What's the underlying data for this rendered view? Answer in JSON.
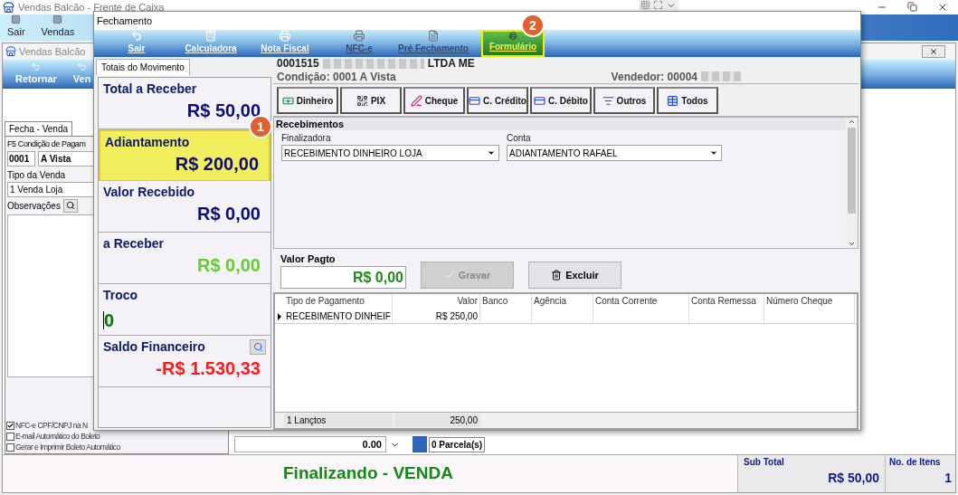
{
  "app": {
    "title": "Vendas Balcão - Frente de Caixa",
    "toolbar": [
      {
        "label": "Sair"
      },
      {
        "label": "Vendas"
      }
    ]
  },
  "child_window": {
    "title": "Vendas Balcão",
    "toolbar": [
      {
        "label": "Retornar"
      },
      {
        "label": "Ven"
      }
    ],
    "tab": {
      "label": "Fecha - Venda",
      "selected": true
    },
    "condition_label": "F5 Condição de Pagam",
    "condition_code": "0001",
    "condition_name": "A Vista",
    "sale_type_label": "Tipo da Venda",
    "sale_type": "1 Venda Loja",
    "notes_label": "Observações",
    "options": [
      {
        "label": "NFC-e CPF/CNPJ na N",
        "checked": true
      },
      {
        "label": "E-mail Automático do Boleto",
        "checked": false
      },
      {
        "label": "Gerar e Imprimir Boleto Automático",
        "checked": false
      }
    ],
    "installment_value": "0.00",
    "installments": "0 Parcela(s)",
    "status": "Finalizando - VENDA",
    "subtotal_label": "Sub Total",
    "subtotal": "R$ 50,00",
    "items_label": "No. de Itens",
    "items": "1"
  },
  "dialog": {
    "title": "Fechamento",
    "toolbar": [
      {
        "label": "Sair",
        "kind": "back",
        "disabled": false,
        "selected": false
      },
      {
        "label": "Calculadora",
        "kind": "calculator",
        "disabled": false,
        "selected": false
      },
      {
        "label": "Nota Fiscal",
        "kind": "printer",
        "disabled": false,
        "selected": false
      },
      {
        "label": "NFC-e",
        "kind": "printer",
        "disabled": true,
        "selected": false
      },
      {
        "label": "Pré Fechamento",
        "kind": "document",
        "disabled": true,
        "selected": false
      },
      {
        "label": "Formulário",
        "kind": "printer",
        "disabled": false,
        "selected": true
      }
    ],
    "totals_tab": {
      "label": "Totais do Movimento",
      "selected": true
    },
    "totals": [
      {
        "label": "Total a Receber",
        "value": "R$ 50,00",
        "color": "#0a0a78",
        "highlighted": false,
        "kind": "amount"
      },
      {
        "label": "Adiantamento",
        "value": "R$ 200,00",
        "color": "#0a0a78",
        "highlighted": true,
        "kind": "amount"
      },
      {
        "label": "Valor Recebido",
        "value": "R$ 0,00",
        "color": "#0a0a78",
        "highlighted": false,
        "kind": "amount"
      },
      {
        "label": "a Receber",
        "value": "R$ 0,00",
        "color": "#66cc33",
        "highlighted": false,
        "kind": "amount"
      },
      {
        "label": "Troco",
        "value": "0",
        "color": "#007a00",
        "highlighted": false,
        "kind": "input"
      },
      {
        "label": "Saldo Financeiro",
        "value": "-R$ 1.530,33",
        "color": "#ff1a1a",
        "highlighted": false,
        "kind": "lookup"
      }
    ],
    "customer_code": "0001515",
    "customer_suffix": "LTDA ME",
    "condition": "Condição: 0001 A Vista",
    "seller": "Vendedor: 00004",
    "payment_buttons": [
      {
        "label": "Dinheiro",
        "kind": "cash"
      },
      {
        "label": "PIX",
        "kind": "pix"
      },
      {
        "label": "Cheque",
        "kind": "check"
      },
      {
        "label": "C. Crédito",
        "kind": "card"
      },
      {
        "label": "C. Débito",
        "kind": "card"
      },
      {
        "label": "Outros",
        "kind": "other"
      },
      {
        "label": "Todos",
        "kind": "all"
      }
    ],
    "receipts": {
      "title": "Recebimentos",
      "method_label": "Finalizadora",
      "method": "RECEBIMENTO DINHEIRO LOJA",
      "account_label": "Conta",
      "account": "ADIANTAMENTO RAFAEL"
    },
    "payment": {
      "label": "Valor Pagto",
      "value": "R$ 0,00",
      "save": {
        "label": "Gravar",
        "disabled": true
      },
      "delete": {
        "label": "Excluir",
        "disabled": false
      }
    },
    "table": {
      "columns": [
        "Tipo de Pagamento",
        "Valor",
        "Banco",
        "Agência",
        "Conta Corrente",
        "Conta Remessa",
        "Número Cheque"
      ],
      "rows": [
        {
          "selected": true,
          "cells": [
            "RECEBIMENTO DINHEIF",
            "R$ 250,00",
            "",
            "",
            "",
            "",
            ""
          ]
        }
      ],
      "footer": [
        "1 Lançtos",
        "250,00"
      ]
    },
    "badges": [
      "1",
      "2"
    ]
  }
}
